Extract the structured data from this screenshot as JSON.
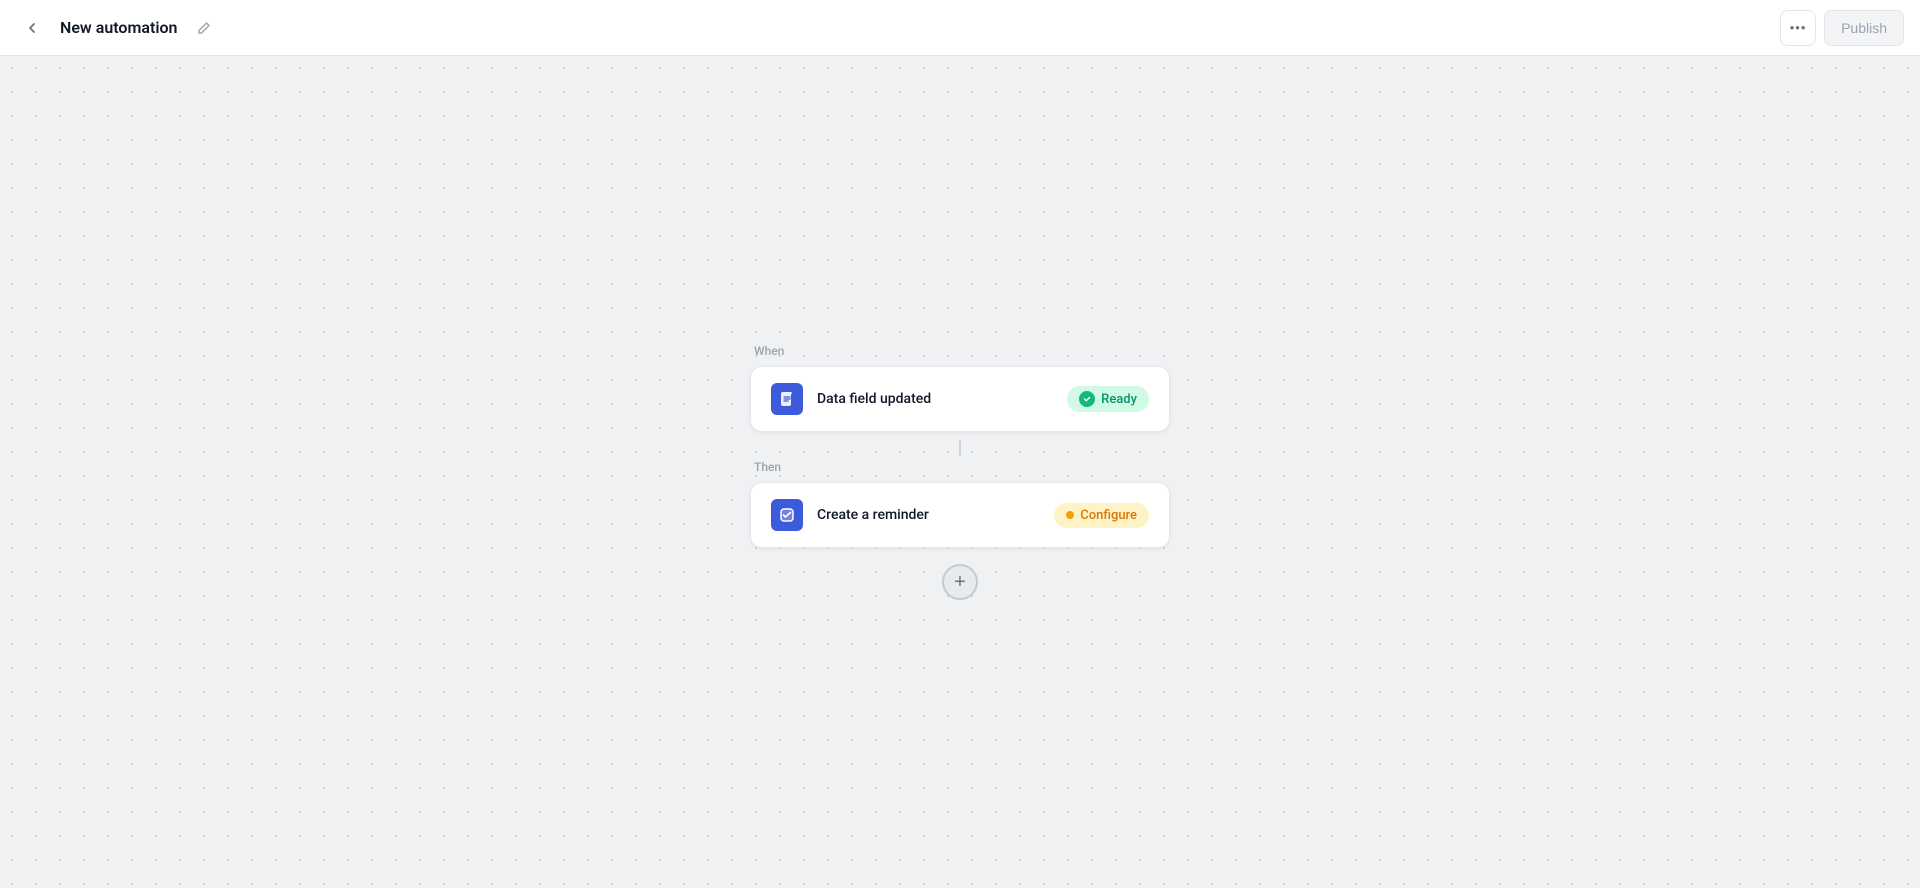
{
  "header": {
    "back_label": "←",
    "title": "New automation",
    "edit_icon": "✏",
    "more_label": "•••",
    "publish_label": "Publish"
  },
  "flow": {
    "when_label": "When",
    "then_label": "Then",
    "trigger": {
      "title": "Data field updated",
      "status_label": "Ready",
      "status_type": "ready"
    },
    "action": {
      "title": "Create a reminder",
      "status_label": "Configure",
      "status_type": "configure"
    },
    "add_button_label": "+"
  }
}
